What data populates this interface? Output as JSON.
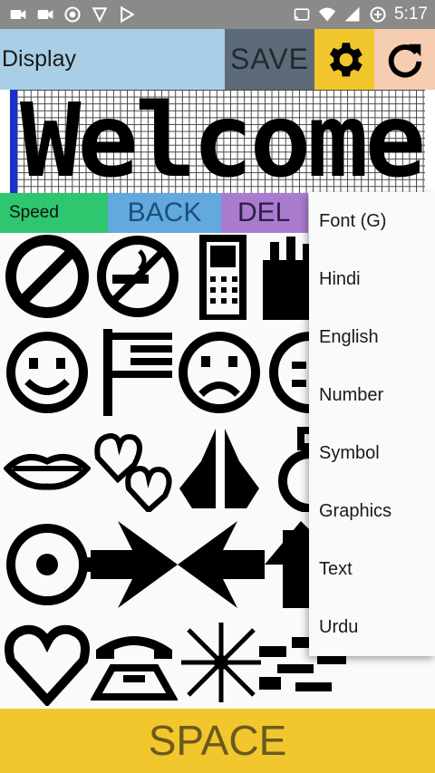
{
  "status_bar": {
    "time": "5:17",
    "icons_left": [
      "video-icon",
      "video-icon",
      "record-icon",
      "game-icon",
      "play-store-icon"
    ],
    "icons_right": [
      "cast-icon",
      "wifi-icon",
      "signal-icon",
      "data-saver-icon"
    ]
  },
  "toolbar": {
    "display_label": "Display",
    "save_label": "SAVE",
    "settings_icon": "gear-icon",
    "refresh_icon": "refresh-icon"
  },
  "led": {
    "text": "Welcome",
    "cursor_color": "#1b2fd1"
  },
  "buttons": {
    "speed_label": "Speed",
    "back_label": "BACK",
    "del_label": "DEL",
    "space_label": "SPACE"
  },
  "symbols": [
    "no-entry-icon",
    "no-smoking-icon",
    "mobile-phone-icon",
    "hand-icon",
    "smiley-face-icon",
    "flag-icon",
    "sad-face-icon",
    "face-icon",
    "lips-icon",
    "hearts-icon",
    "praying-hands-icon",
    "ring-icon",
    "target-arrow-icon",
    "arrow-right-icon",
    "arrow-left-icon",
    "arrow-icon",
    "heart-icon",
    "telephone-icon",
    "sparkle-icon",
    "pattern-icon"
  ],
  "dropdown": {
    "items": [
      "Font (G)",
      "Hindi",
      "English",
      "Number",
      "Symbol",
      "Graphics",
      "Text",
      "Urdu"
    ]
  },
  "colors": {
    "display_bg": "#a9cfe6",
    "save_bg": "#5d6b78",
    "settings_bg": "#f2c72e",
    "refresh_bg": "#f6cdb0",
    "speed_bg": "#2ec76f",
    "back_bg": "#61a9df",
    "del_bg": "#a97cd0",
    "space_bg": "#f2c72e"
  }
}
